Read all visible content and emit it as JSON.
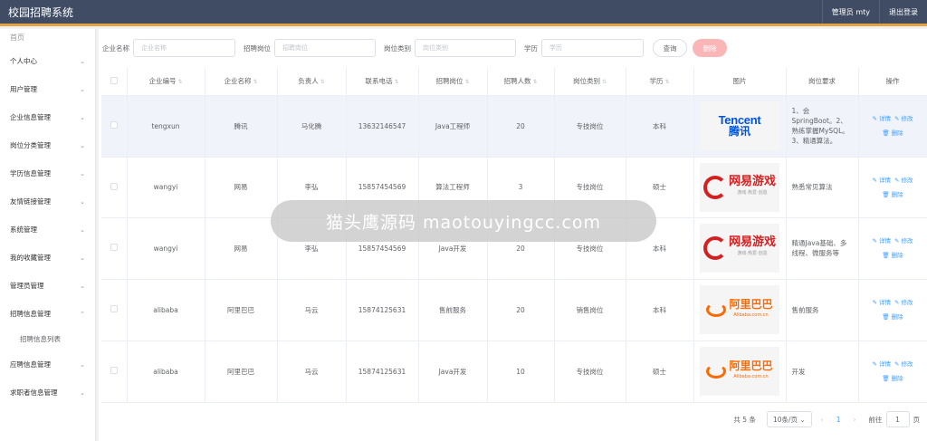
{
  "app": {
    "title": "校园招聘系统",
    "admin": "管理员 mty",
    "logout": "退出登录"
  },
  "sidebar": {
    "home": "首页",
    "items": [
      {
        "label": "个人中心",
        "chev": "⌄"
      },
      {
        "label": "用户管理",
        "chev": "⌄"
      },
      {
        "label": "企业信息管理",
        "chev": "⌄"
      },
      {
        "label": "岗位分类管理",
        "chev": "⌄"
      },
      {
        "label": "学历信息管理",
        "chev": "⌄"
      },
      {
        "label": "友情链接管理",
        "chev": "⌄"
      },
      {
        "label": "系统管理",
        "chev": "⌄"
      },
      {
        "label": "我的收藏管理",
        "chev": "⌄"
      },
      {
        "label": "管理员管理",
        "chev": "⌄"
      },
      {
        "label": "招聘信息管理",
        "chev": "⌃"
      },
      {
        "label": "应聘信息管理",
        "chev": "⌄"
      },
      {
        "label": "求职者信息管理",
        "chev": "⌄"
      }
    ],
    "sub_item": "招聘信息列表"
  },
  "filters": {
    "company_label": "企业名称",
    "company_placeholder": "企业名称",
    "position_label": "招聘岗位",
    "position_placeholder": "招聘岗位",
    "category_label": "岗位类别",
    "category_placeholder": "岗位类别",
    "edu_label": "学历",
    "edu_placeholder": "学历",
    "search_btn": "查询",
    "delete_btn": "删除"
  },
  "table": {
    "headers": [
      "企业编号",
      "企业名称",
      "负责人",
      "联系电话",
      "招聘岗位",
      "招聘人数",
      "岗位类别",
      "学历",
      "图片",
      "岗位要求",
      "操作"
    ],
    "ops": {
      "detail": "✎ 详情",
      "edit": "✎ 修改",
      "delete": "🗑 删除"
    },
    "rows": [
      {
        "code": "tengxun",
        "name": "腾讯",
        "owner": "马化腾",
        "phone": "13632146547",
        "position": "Java工程师",
        "count": "20",
        "category": "专技岗位",
        "edu": "本科",
        "logo": "tencent",
        "req": "1、会SpringBoot。2、熟练掌握MySQL。3、精通算法。"
      },
      {
        "code": "wangyi",
        "name": "网易",
        "owner": "李弘",
        "phone": "15857454569",
        "position": "算法工程师",
        "count": "3",
        "category": "专技岗位",
        "edu": "硕士",
        "logo": "wangyi",
        "req": "熟悉常见算法"
      },
      {
        "code": "wangyi",
        "name": "网易",
        "owner": "李弘",
        "phone": "15857454569",
        "position": "Java开发",
        "count": "20",
        "category": "专技岗位",
        "edu": "本科",
        "logo": "wangyi",
        "req": "精通Java基础、多线程、微服务等"
      },
      {
        "code": "alibaba",
        "name": "阿里巴巴",
        "owner": "马云",
        "phone": "15874125631",
        "position": "售前服务",
        "count": "20",
        "category": "销售岗位",
        "edu": "本科",
        "logo": "alibaba",
        "req": "售前服务"
      },
      {
        "code": "alibaba",
        "name": "阿里巴巴",
        "owner": "马云",
        "phone": "15874125631",
        "position": "Java开发",
        "count": "10",
        "category": "专技岗位",
        "edu": "硕士",
        "logo": "alibaba",
        "req": "开发"
      }
    ]
  },
  "logos": {
    "tencent_en": "Tencent",
    "tencent_cn": "腾讯",
    "wangyi_cn": "网易游戏",
    "wangyi_sub": "游戏·热爱·创造",
    "alibaba_cn": "阿里巴巴",
    "alibaba_sub": "Alibaba.com.cn"
  },
  "pager": {
    "total": "共 5 条",
    "size": "10条/页",
    "current": "1",
    "goto": "前往",
    "page_value": "1",
    "page_unit": "页"
  },
  "watermark": "猫头鹰源码 maotouyingcc.com",
  "colors": {
    "topbar": "#3f4c63",
    "accent": "#e6a23c",
    "link": "#409eff",
    "danger": "#fab6b6"
  }
}
